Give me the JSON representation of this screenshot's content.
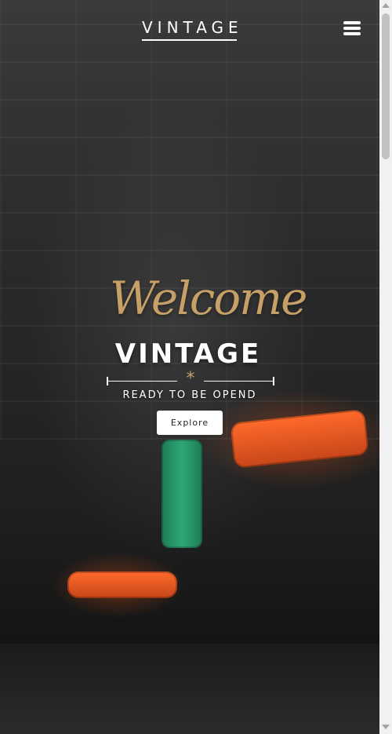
{
  "header": {
    "brand": "VINTAGE",
    "menu_icon": "hamburger-menu-icon"
  },
  "hero": {
    "welcome": "Welcome",
    "title": "VINTAGE",
    "divider_icon": "star-icon",
    "divider_glyph": "*",
    "tagline": "READY TO BE OPEND",
    "cta_label": "Explore"
  },
  "colors": {
    "accent_gold": "#c6a067",
    "text_white": "#ffffff",
    "button_bg": "#ffffff",
    "button_text": "#222222"
  }
}
